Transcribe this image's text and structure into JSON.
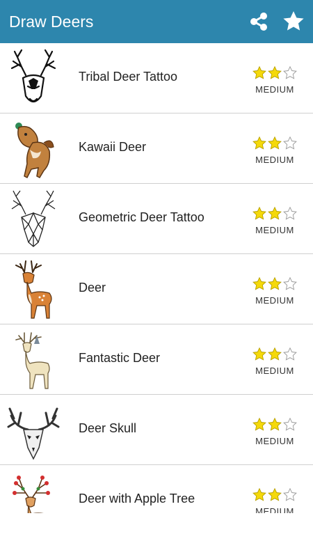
{
  "appbar": {
    "title": "Draw Deers",
    "share_icon": "share-icon",
    "favorite_icon": "star-icon"
  },
  "colors": {
    "primary": "#2d86ad",
    "star_filled": "#f5d90a",
    "star_empty": "#ffffff"
  },
  "items": [
    {
      "title": "Tribal Deer Tattoo",
      "difficulty": "MEDIUM",
      "stars": 2,
      "max_stars": 3,
      "icon": "tribal-deer-icon"
    },
    {
      "title": "Kawaii Deer",
      "difficulty": "MEDIUM",
      "stars": 2,
      "max_stars": 3,
      "icon": "kawaii-deer-icon"
    },
    {
      "title": "Geometric Deer Tattoo",
      "difficulty": "MEDIUM",
      "stars": 2,
      "max_stars": 3,
      "icon": "geometric-deer-icon"
    },
    {
      "title": "Deer",
      "difficulty": "MEDIUM",
      "stars": 2,
      "max_stars": 3,
      "icon": "deer-icon"
    },
    {
      "title": "Fantastic Deer",
      "difficulty": "MEDIUM",
      "stars": 2,
      "max_stars": 3,
      "icon": "fantastic-deer-icon"
    },
    {
      "title": "Deer Skull",
      "difficulty": "MEDIUM",
      "stars": 2,
      "max_stars": 3,
      "icon": "deer-skull-icon"
    },
    {
      "title": "Deer with Apple Tree",
      "difficulty": "MEDIUM",
      "stars": 2,
      "max_stars": 3,
      "icon": "apple-tree-deer-icon"
    }
  ]
}
